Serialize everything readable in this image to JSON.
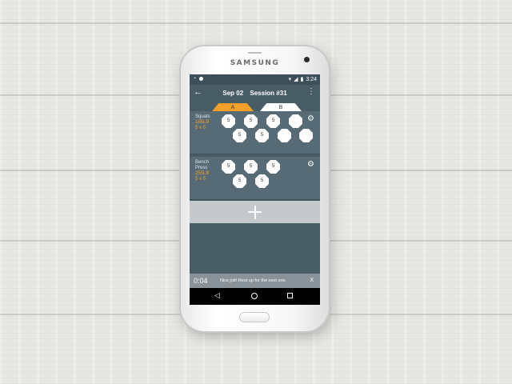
{
  "device": {
    "brand": "SAMSUNG"
  },
  "status_bar": {
    "time": "3:24",
    "left_icons": [
      "alarm-icon",
      "notification-dot-icon"
    ],
    "right_icons": [
      "wifi-icon",
      "signal-icon",
      "battery-icon"
    ]
  },
  "app_bar": {
    "back_icon": "arrow-left-icon",
    "date": "Sep 02",
    "session": "Session  #31",
    "menu_icon": "more-vert-icon"
  },
  "tabs": [
    {
      "label": "A",
      "active": true
    },
    {
      "label": "B",
      "active": false
    }
  ],
  "exercises": [
    {
      "name": "Squats",
      "weight": "185LB",
      "scheme": "5 x 5",
      "sets": [
        "5",
        "5",
        "5",
        "5",
        "5",
        "",
        "",
        "",
        ""
      ]
    },
    {
      "name": "Bench Press",
      "name_line1": "Bench",
      "name_line2": "Press",
      "weight": "255LB",
      "scheme": "5 x 5",
      "sets": [
        "5",
        "5",
        "5",
        "5",
        "5"
      ]
    }
  ],
  "add_button": {
    "icon": "plus-icon"
  },
  "timer": {
    "value": "0:04",
    "message": "Nice job! Rest up for the next one.",
    "close_label": "X"
  },
  "nav": {
    "back": "◁",
    "home_icon": "circle-home-icon",
    "recent_icon": "square-recent-icon"
  },
  "colors": {
    "accent": "#f5a02a",
    "background": "#485c66",
    "card": "#566b76"
  }
}
